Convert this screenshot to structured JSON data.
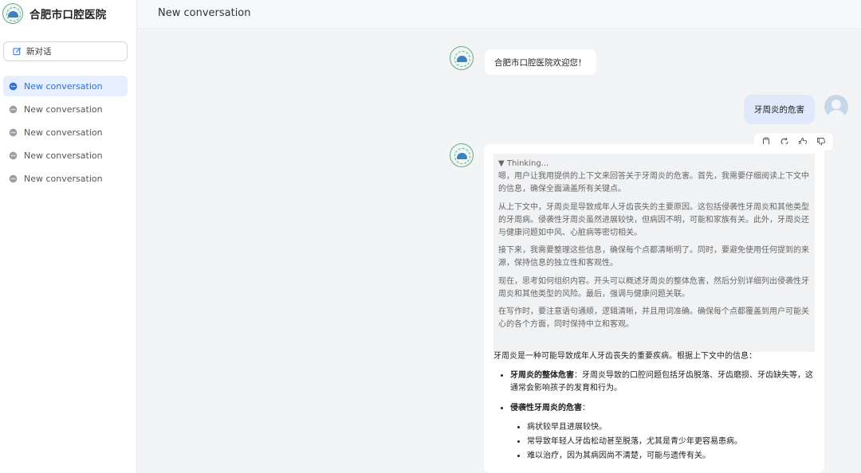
{
  "sidebar": {
    "brand_name": "合肥市口腔医院",
    "new_chat_label": "新对话",
    "items": [
      {
        "label": "New conversation"
      },
      {
        "label": "New conversation"
      },
      {
        "label": "New conversation"
      },
      {
        "label": "New conversation"
      },
      {
        "label": "New conversation"
      }
    ]
  },
  "header": {
    "title": "New conversation"
  },
  "chat": {
    "welcome": "合肥市口腔医院欢迎您！",
    "user_question": "牙周炎的危害",
    "thinking": {
      "label": "▼ Thinking...",
      "paragraphs": [
        "嗯，用户让我用提供的上下文来回答关于牙周炎的危害。首先，我需要仔细阅读上下文中的信息，确保全面涵盖所有关键点。",
        "从上下文中，牙周炎是导致成年人牙齿丧失的主要原因。这包括侵袭性牙周炎和其他类型的牙周病。侵袭性牙周炎虽然进展较快，但病因不明，可能和家族有关。此外，牙周炎还与健康问题如中风、心脏病等密切相关。",
        "接下来，我需要整理这些信息，确保每个点都清晰明了。同时，要避免使用任何提到的来源，保持信息的独立性和客观性。",
        "现在，思考如何组织内容。开头可以概述牙周炎的整体危害，然后分别详细列出侵袭性牙周炎和其他类型的风险。最后，强调与健康问题关联。",
        "在写作时，要注意语句通顺，逻辑清晰，并且用词准确。确保每个点都覆盖到用户可能关心的各个方面，同时保持中立和客观。"
      ]
    },
    "answer": {
      "intro": "牙周炎是一种可能导致成年人牙齿丧失的重要疾病。根据上下文中的信息：",
      "point1_title": "牙周炎的整体危害",
      "point1_text": "：牙周炎导致的口腔问题包括牙齿脱落、牙齿磨损、牙齿缺失等，这通常会影响孩子的发育和行为。",
      "point2_title": "侵袭性牙周炎的危害",
      "point2_colon": "：",
      "sub_points": [
        "病状较早且进展较快。",
        "常导致年轻人牙齿松动甚至脱落，尤其是青少年更容易患病。",
        "难以治疗，因为其病因尚不清楚，可能与遗传有关。"
      ]
    }
  },
  "colors": {
    "accent": "#2f6fde",
    "active_bg": "#e6efff",
    "user_bubble": "#dfe9fb"
  }
}
